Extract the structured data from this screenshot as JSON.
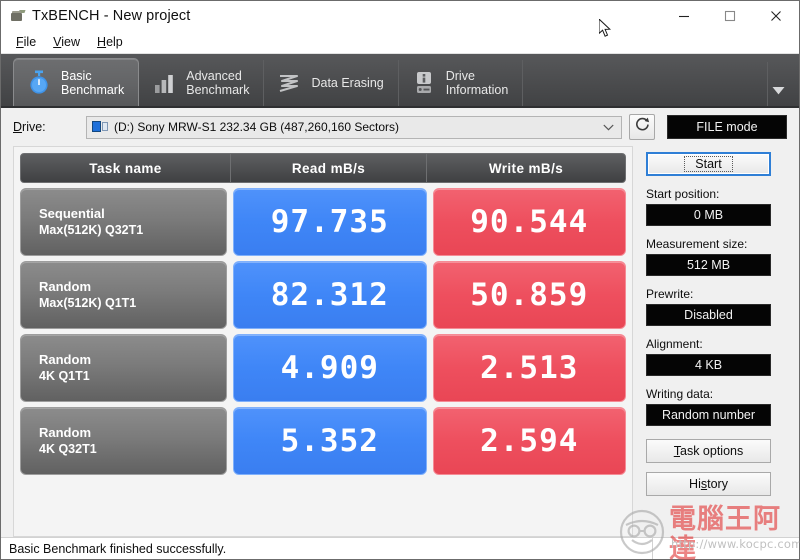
{
  "window": {
    "title": "TxBENCH - New project",
    "app_icon": "txbench-app-icon",
    "controls": {
      "minimize": "minimize-icon",
      "maximize": "maximize-icon",
      "close": "close-icon"
    }
  },
  "menubar": {
    "items": [
      {
        "label": "File",
        "accel": "F"
      },
      {
        "label": "View",
        "accel": "V"
      },
      {
        "label": "Help",
        "accel": "H"
      }
    ]
  },
  "tabs": {
    "items": [
      {
        "label": "Basic\nBenchmark",
        "icon": "stopwatch-icon",
        "active": true
      },
      {
        "label": "Advanced\nBenchmark",
        "icon": "bar-chart-icon",
        "active": false
      },
      {
        "label": "Data Erasing",
        "icon": "wave-shred-icon",
        "active": false
      },
      {
        "label": "Drive\nInformation",
        "icon": "drive-info-icon",
        "active": false
      }
    ],
    "overflow_icon": "chevron-down-icon"
  },
  "drive_row": {
    "label": "Drive:",
    "selected": "(D:) Sony MRW-S1  232.34 GB (487,260,160 Sectors)",
    "combo_icon": "removable-drive-icon",
    "dropdown_icon": "chevron-down-icon",
    "refresh_icon": "refresh-icon",
    "mode_badge": "FILE mode"
  },
  "results": {
    "columns": [
      "Task name",
      "Read mB/s",
      "Write mB/s"
    ],
    "rows": [
      {
        "task_line1": "Sequential",
        "task_line2": "Max(512K) Q32T1",
        "read": "97.735",
        "write": "90.544"
      },
      {
        "task_line1": "Random",
        "task_line2": "Max(512K) Q1T1",
        "read": "82.312",
        "write": "50.859"
      },
      {
        "task_line1": "Random",
        "task_line2": "4K Q1T1",
        "read": "4.909",
        "write": "2.513"
      },
      {
        "task_line1": "Random",
        "task_line2": "4K Q32T1",
        "read": "5.352",
        "write": "2.594"
      }
    ]
  },
  "sidebar": {
    "start_button": "Start",
    "start_position_label": "Start position:",
    "start_position_value": "0 MB",
    "measurement_size_label": "Measurement size:",
    "measurement_size_value": "512 MB",
    "prewrite_label": "Prewrite:",
    "prewrite_value": "Disabled",
    "alignment_label": "Alignment:",
    "alignment_value": "4 KB",
    "writing_data_label": "Writing data:",
    "writing_data_value": "Random number",
    "task_options_button": "Task options",
    "history_button": "History"
  },
  "statusbar": {
    "message": "Basic Benchmark finished successfully."
  },
  "watermark": {
    "text": "電腦王阿達",
    "url": "http://www.kocpc.com.tw",
    "face_icon": "mascot-face-icon"
  },
  "colors": {
    "read_blue": "#3f86f7",
    "write_red": "#ee4f5e",
    "tab_bar": "#4c4d4f",
    "accent_focus": "#2f7fd6"
  }
}
